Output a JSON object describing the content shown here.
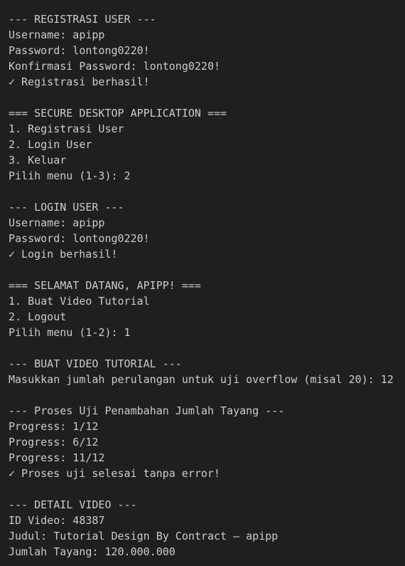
{
  "registration": {
    "header": "--- REGISTRASI USER ---",
    "username": "Username: apipp",
    "password": "Password: lontong0220!",
    "confirm": "Konfirmasi Password: lontong0220!",
    "check_icon": "✓",
    "success": "Registrasi berhasil!"
  },
  "main_menu": {
    "header": "=== SECURE DESKTOP APPLICATION ===",
    "items": [
      "1. Registrasi User",
      "2. Login User",
      "3. Keluar"
    ],
    "prompt": "Pilih menu (1-3): 2"
  },
  "login": {
    "header": "--- LOGIN USER ---",
    "username": "Username: apipp",
    "password": "Password: lontong0220!",
    "check_icon": "✓",
    "success": "Login berhasil!"
  },
  "user_menu": {
    "header": "=== SELAMAT DATANG, APIPP! ===",
    "items": [
      "1. Buat Video Tutorial",
      "2. Logout"
    ],
    "prompt": "Pilih menu (1-2): 1"
  },
  "create_video": {
    "header": "--- BUAT VIDEO TUTORIAL ---",
    "prompt": "Masukkan jumlah perulangan untuk uji overflow (misal 20): 12"
  },
  "test_process": {
    "header": "--- Proses Uji Penambahan Jumlah Tayang ---",
    "progress": [
      "Progress: 1/12",
      "Progress: 6/12",
      "Progress: 11/12"
    ],
    "check_icon": "✓",
    "success": "Proses uji selesai tanpa error!"
  },
  "video_detail": {
    "header": "--- DETAIL VIDEO ---",
    "id": "ID Video: 48387",
    "title": "Judul: Tutorial Design By Contract – apipp",
    "views": "Jumlah Tayang: 120.000.000"
  },
  "colors": {
    "background": "#1f1f1f",
    "text": "#cccccc"
  }
}
